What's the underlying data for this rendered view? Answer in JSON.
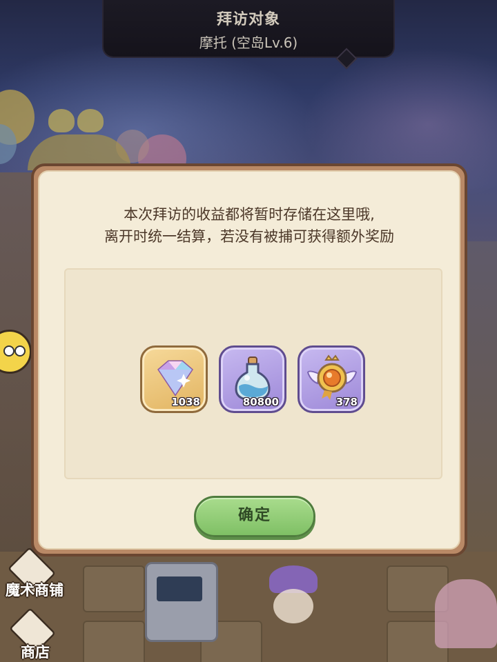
{
  "header": {
    "title": "拜访对象",
    "subtitle": "摩托 (空岛Lv.6)"
  },
  "dialog": {
    "message_line1": "本次拜访的收益都将暂时存储在这里哦,",
    "message_line2": "离开时统一结算，若没有被捕可获得额外奖励",
    "rewards": [
      {
        "icon": "diamond-icon",
        "count": "1038",
        "frame": "gold"
      },
      {
        "icon": "potion-bottle-icon",
        "count": "80800",
        "frame": "purple"
      },
      {
        "icon": "winged-medal-icon",
        "count": "378",
        "frame": "purple"
      }
    ],
    "confirm_label": "确定"
  },
  "background": {
    "magic_shop_label": "魔术商铺",
    "shop_label": "商店"
  },
  "colors": {
    "panel_bg": "#f4ecd8",
    "panel_border": "#6a4631",
    "confirm_green": "#8fcb74",
    "text_brown": "#4b3728"
  }
}
